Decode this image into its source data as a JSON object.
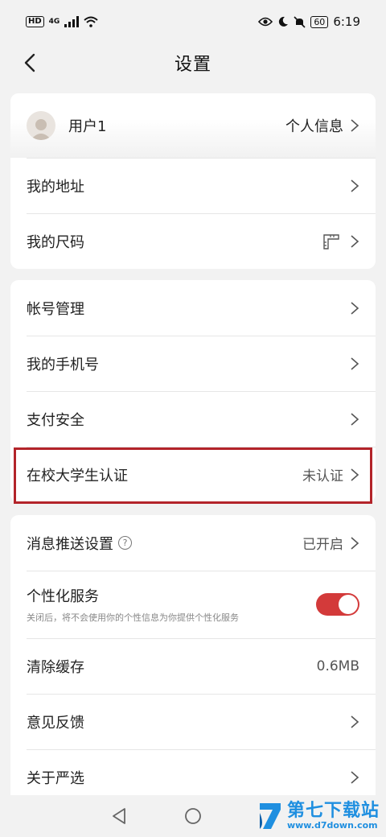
{
  "status_bar": {
    "hd": "HD",
    "network": "4G",
    "battery": "60",
    "time": "6:19"
  },
  "header": {
    "title": "设置"
  },
  "user": {
    "name": "用户1",
    "link_label": "个人信息"
  },
  "card1": {
    "address": "我的地址",
    "size": "我的尺码"
  },
  "card2": {
    "account": "帐号管理",
    "phone": "我的手机号",
    "payment": "支付安全",
    "student": {
      "label": "在校大学生认证",
      "value": "未认证"
    }
  },
  "card3": {
    "push": {
      "label": "消息推送设置",
      "value": "已开启"
    },
    "personal": {
      "label": "个性化服务",
      "desc": "关闭后，将不会使用你的个性信息为你提供个性化服务",
      "enabled": true
    },
    "cache": {
      "label": "清除缓存",
      "value": "0.6MB"
    },
    "feedback": "意见反馈",
    "about": "关于严选"
  },
  "colors": {
    "accent": "#d33a3a",
    "highlight": "#b3242a",
    "watermark": "#1f8fe0"
  },
  "watermark": {
    "text": "第七下载站",
    "url": "www.d7down.com"
  }
}
